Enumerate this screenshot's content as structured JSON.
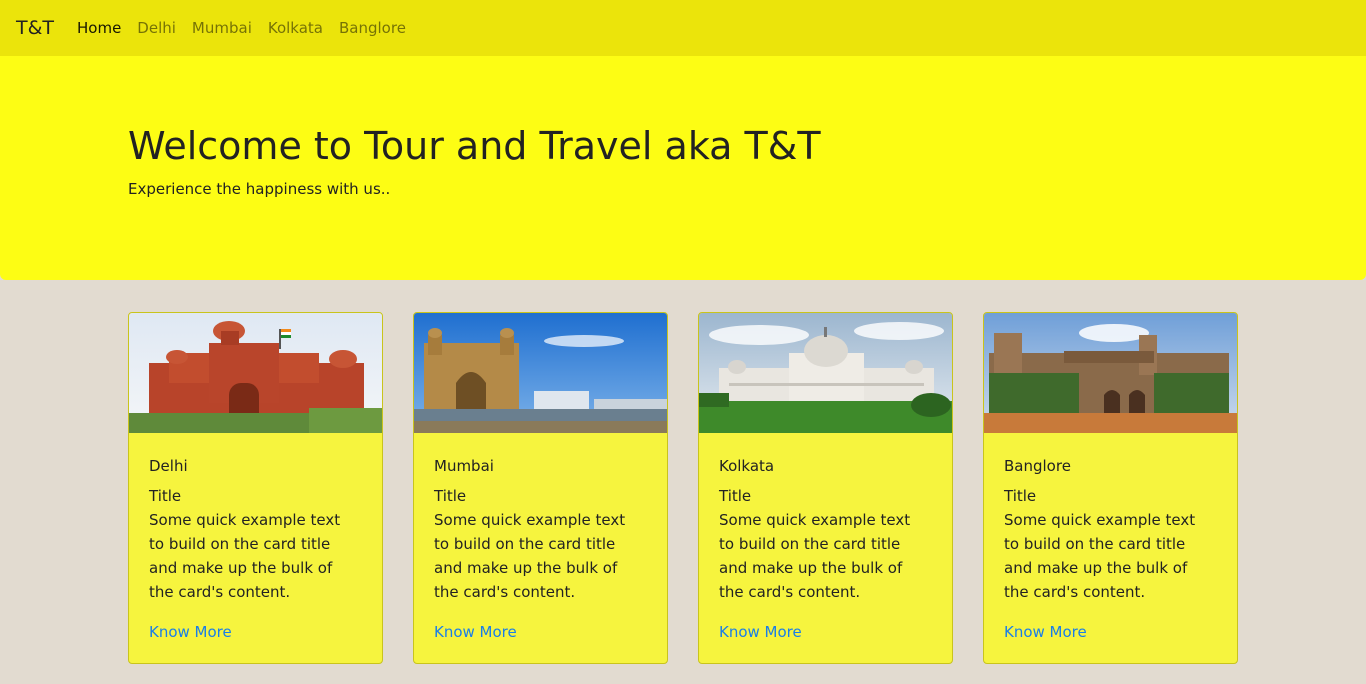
{
  "navbar": {
    "brand": "T&T",
    "links": [
      "Home",
      "Delhi",
      "Mumbai",
      "Kolkata",
      "Banglore"
    ],
    "active_link": "Home",
    "background": "#ebe40b"
  },
  "hero": {
    "title": "Welcome to Tour and Travel aka T&T",
    "subtitle": "Experience the happiness with us..",
    "background": "#fdfd14"
  },
  "cards": [
    {
      "city": "Delhi",
      "title": "Title",
      "text": "Some quick example text to build on the card title and make up the bulk of the card's content.",
      "link": "Know More",
      "image": "red-fort-photo"
    },
    {
      "city": "Mumbai",
      "title": "Title",
      "text": "Some quick example text to build on the card title and make up the bulk of the card's content.",
      "link": "Know More",
      "image": "gateway-of-india-photo"
    },
    {
      "city": "Kolkata",
      "title": "Title",
      "text": "Some quick example text to build on the card title and make up the bulk of the card's content.",
      "link": "Know More",
      "image": "victoria-memorial-photo"
    },
    {
      "city": "Banglore",
      "title": "Title",
      "text": "Some quick example text to build on the card title and make up the bulk of the card's content.",
      "link": "Know More",
      "image": "bangalore-palace-photo"
    }
  ],
  "colors": {
    "page_background": "#e2dbd0",
    "card_background": "#f6f43e",
    "link": "#1a7ee8"
  }
}
